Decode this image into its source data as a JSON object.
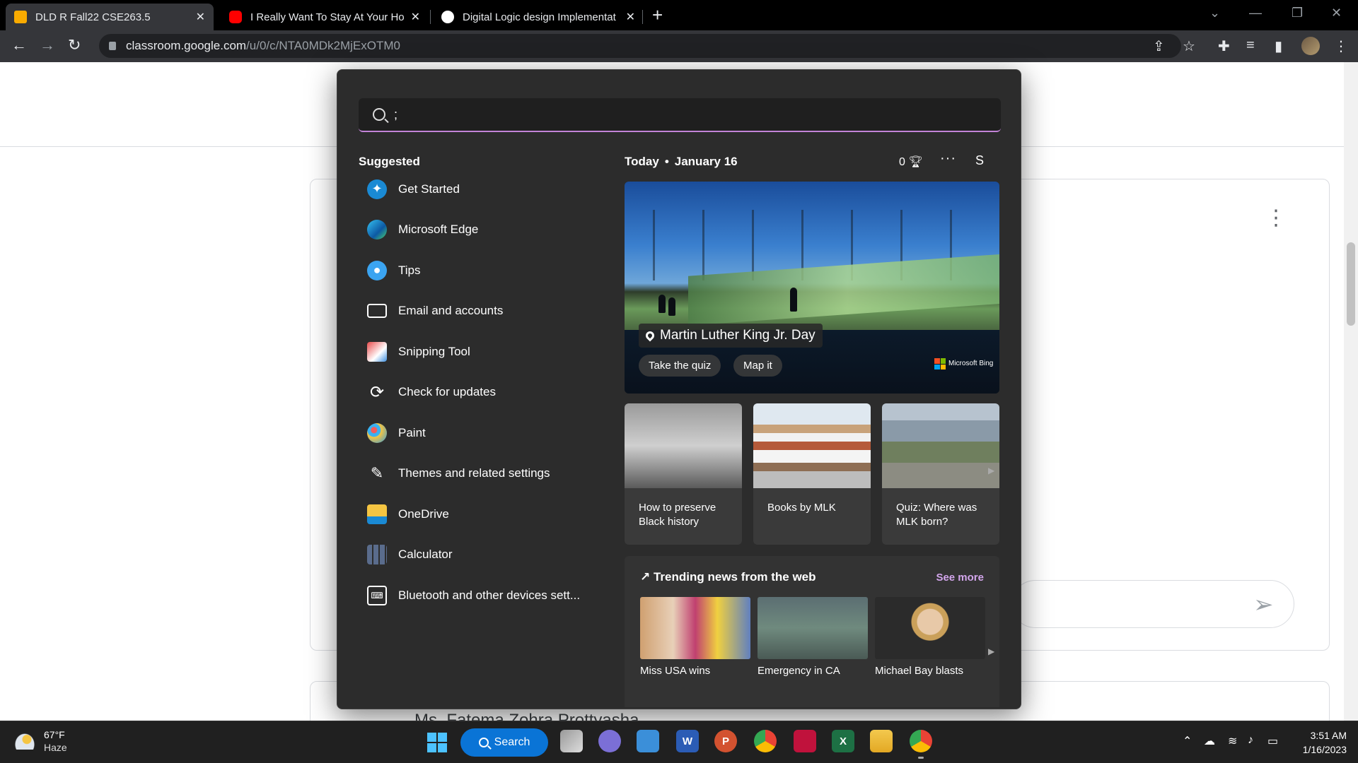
{
  "browser": {
    "tabs": [
      {
        "title": "DLD R Fall22 CSE263.5",
        "favicon_color": "#f9ab00"
      },
      {
        "title": "I Really Want To Stay At Your Hou",
        "favicon_color": "#ff0000"
      },
      {
        "title": "Digital Logic design Implementat",
        "favicon_color": "#ffffff"
      }
    ],
    "url_host": "classroom.google.com",
    "url_path": "/u/0/c/NTA0MDk2MjExOTM0"
  },
  "page": {
    "teacher_name": "Ms. Fatema Zohra Prottyasha"
  },
  "search": {
    "query": ";",
    "suggested_heading": "Suggested",
    "suggestions": [
      {
        "label": "Get Started",
        "icon": "get-started-icon"
      },
      {
        "label": "Microsoft Edge",
        "icon": "edge-icon"
      },
      {
        "label": "Tips",
        "icon": "tips-icon"
      },
      {
        "label": "Email and accounts",
        "icon": "mail-icon"
      },
      {
        "label": "Snipping Tool",
        "icon": "snipping-tool-icon"
      },
      {
        "label": "Check for updates",
        "icon": "refresh-icon"
      },
      {
        "label": "Paint",
        "icon": "paint-icon"
      },
      {
        "label": "Themes and related settings",
        "icon": "brush-icon"
      },
      {
        "label": "OneDrive",
        "icon": "onedrive-icon"
      },
      {
        "label": "Calculator",
        "icon": "calculator-icon"
      },
      {
        "label": "Bluetooth and other devices sett...",
        "icon": "devices-icon"
      }
    ],
    "today_label": "Today",
    "date": "January 16",
    "points": "0",
    "user_initial": "S",
    "hero": {
      "title": "Martin Luther King Jr. Day",
      "buttons": [
        "Take the quiz",
        "Map it"
      ],
      "brand": "Microsoft Bing"
    },
    "tiles": [
      {
        "caption": "How to preserve Black history"
      },
      {
        "caption": "Books by MLK"
      },
      {
        "caption": "Quiz: Where was MLK born?"
      }
    ],
    "trending": {
      "heading": "Trending news from the web",
      "see_more": "See more",
      "items": [
        "Miss USA wins",
        "Emergency in CA",
        "Michael Bay blasts"
      ]
    }
  },
  "taskbar": {
    "weather_temp": "67°F",
    "weather_desc": "Haze",
    "search_label": "Search",
    "time": "3:51 AM",
    "date": "1/16/2023"
  },
  "colors": {
    "accent": "#c383d8",
    "taskbar_search": "#0a74d6",
    "see_more": "#d3a6ec"
  }
}
